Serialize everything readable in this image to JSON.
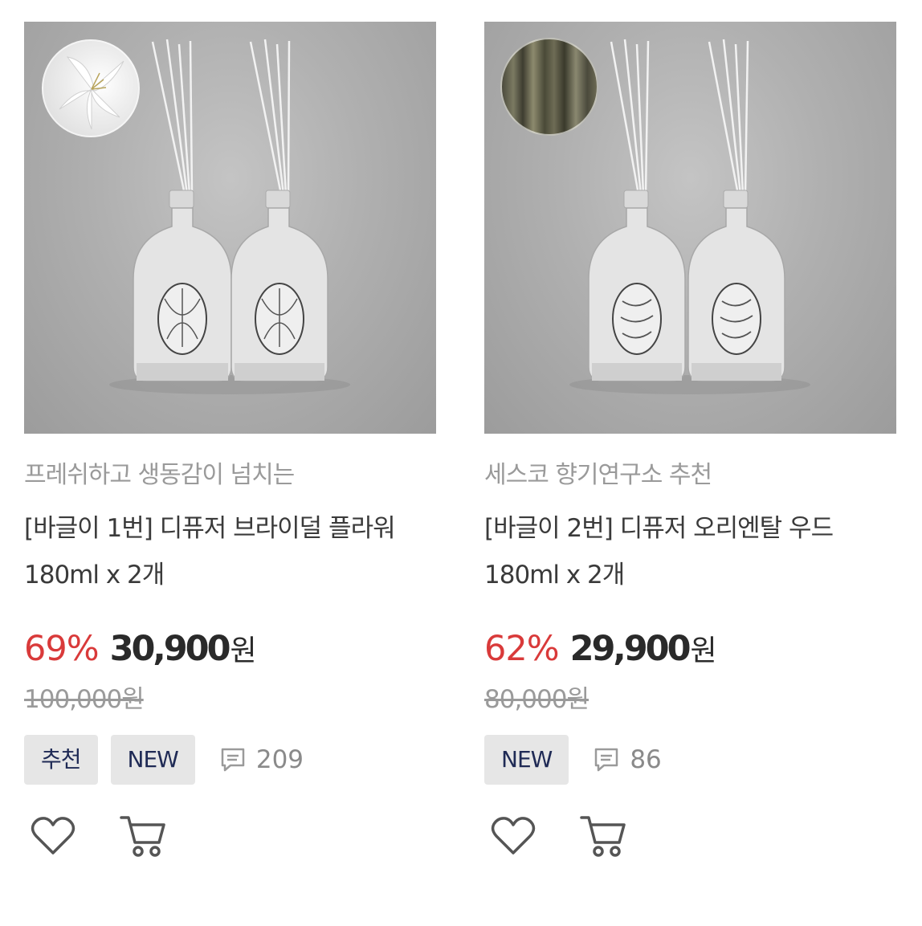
{
  "products": [
    {
      "subtitle": "프레쉬하고 생동감이 넘치는",
      "title": "[바글이 1번] 디퓨저 브라이덜 플라워 180ml x 2개",
      "discount": "69%",
      "price": "30,900",
      "currency": "원",
      "original_price": "100,000원",
      "tags": [
        "추천",
        "NEW"
      ],
      "review_count": "209",
      "swatch": "white-lily"
    },
    {
      "subtitle": "세스코 향기연구소 추천",
      "title": "[바글이 2번] 디퓨저 오리엔탈 우드 180ml x 2개",
      "discount": "62%",
      "price": "29,900",
      "currency": "원",
      "original_price": "80,000원",
      "tags": [
        "NEW"
      ],
      "review_count": "86",
      "swatch": "forest-trees"
    }
  ],
  "colors": {
    "discount": "#d93a3a",
    "tag_text": "#1f2a55",
    "tag_bg": "#e6e6e6"
  }
}
